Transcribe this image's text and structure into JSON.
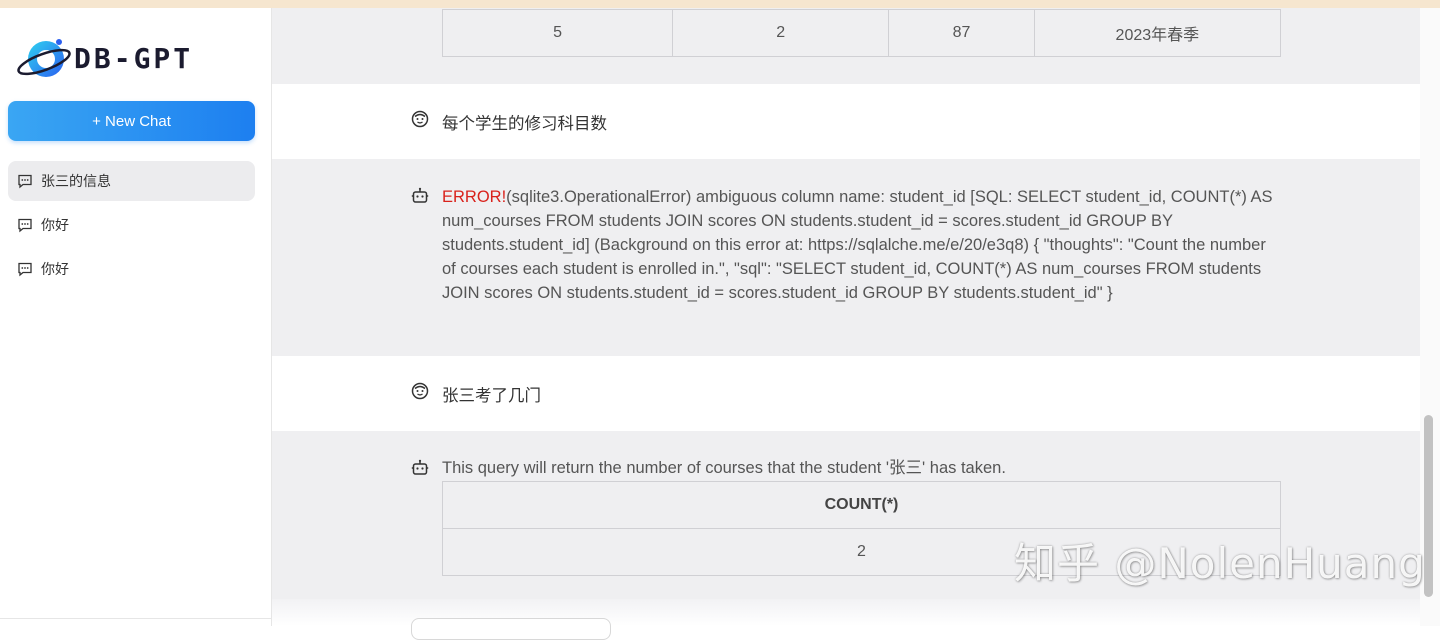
{
  "app": {
    "logo_text": "DB-GPT"
  },
  "sidebar": {
    "new_chat_label": "+ New Chat",
    "conversations": [
      {
        "label": "张三的信息",
        "active": true
      },
      {
        "label": "你好",
        "active": false
      },
      {
        "label": "你好",
        "active": false
      }
    ]
  },
  "messages": {
    "prev_table": {
      "cells": [
        "5",
        "2",
        "87",
        "2023年春季"
      ]
    },
    "user1": {
      "text": "每个学生的修习科目数"
    },
    "bot1": {
      "error_label": "ERROR!",
      "error_text": "(sqlite3.OperationalError) ambiguous column name: student_id [SQL: SELECT student_id, COUNT(*) AS num_courses FROM students JOIN scores ON students.student_id = scores.student_id GROUP BY students.student_id] (Background on this error at: https://sqlalche.me/e/20/e3q8) { \"thoughts\": \"Count the number of courses each student is enrolled in.\", \"sql\": \"SELECT student_id, COUNT(*) AS num_courses FROM students JOIN scores ON students.student_id = scores.student_id GROUP BY students.student_id\" }"
    },
    "user2": {
      "text": "张三考了几门"
    },
    "bot2": {
      "text": "This query will return the number of courses that the student '张三' has taken.",
      "table": {
        "header": "COUNT(*)",
        "value": "2"
      }
    }
  },
  "watermark": "知乎 @NolenHuang",
  "colors": {
    "accent": "#1d7ff0",
    "error": "#d9221c",
    "bot_bg": "#efeff1"
  }
}
